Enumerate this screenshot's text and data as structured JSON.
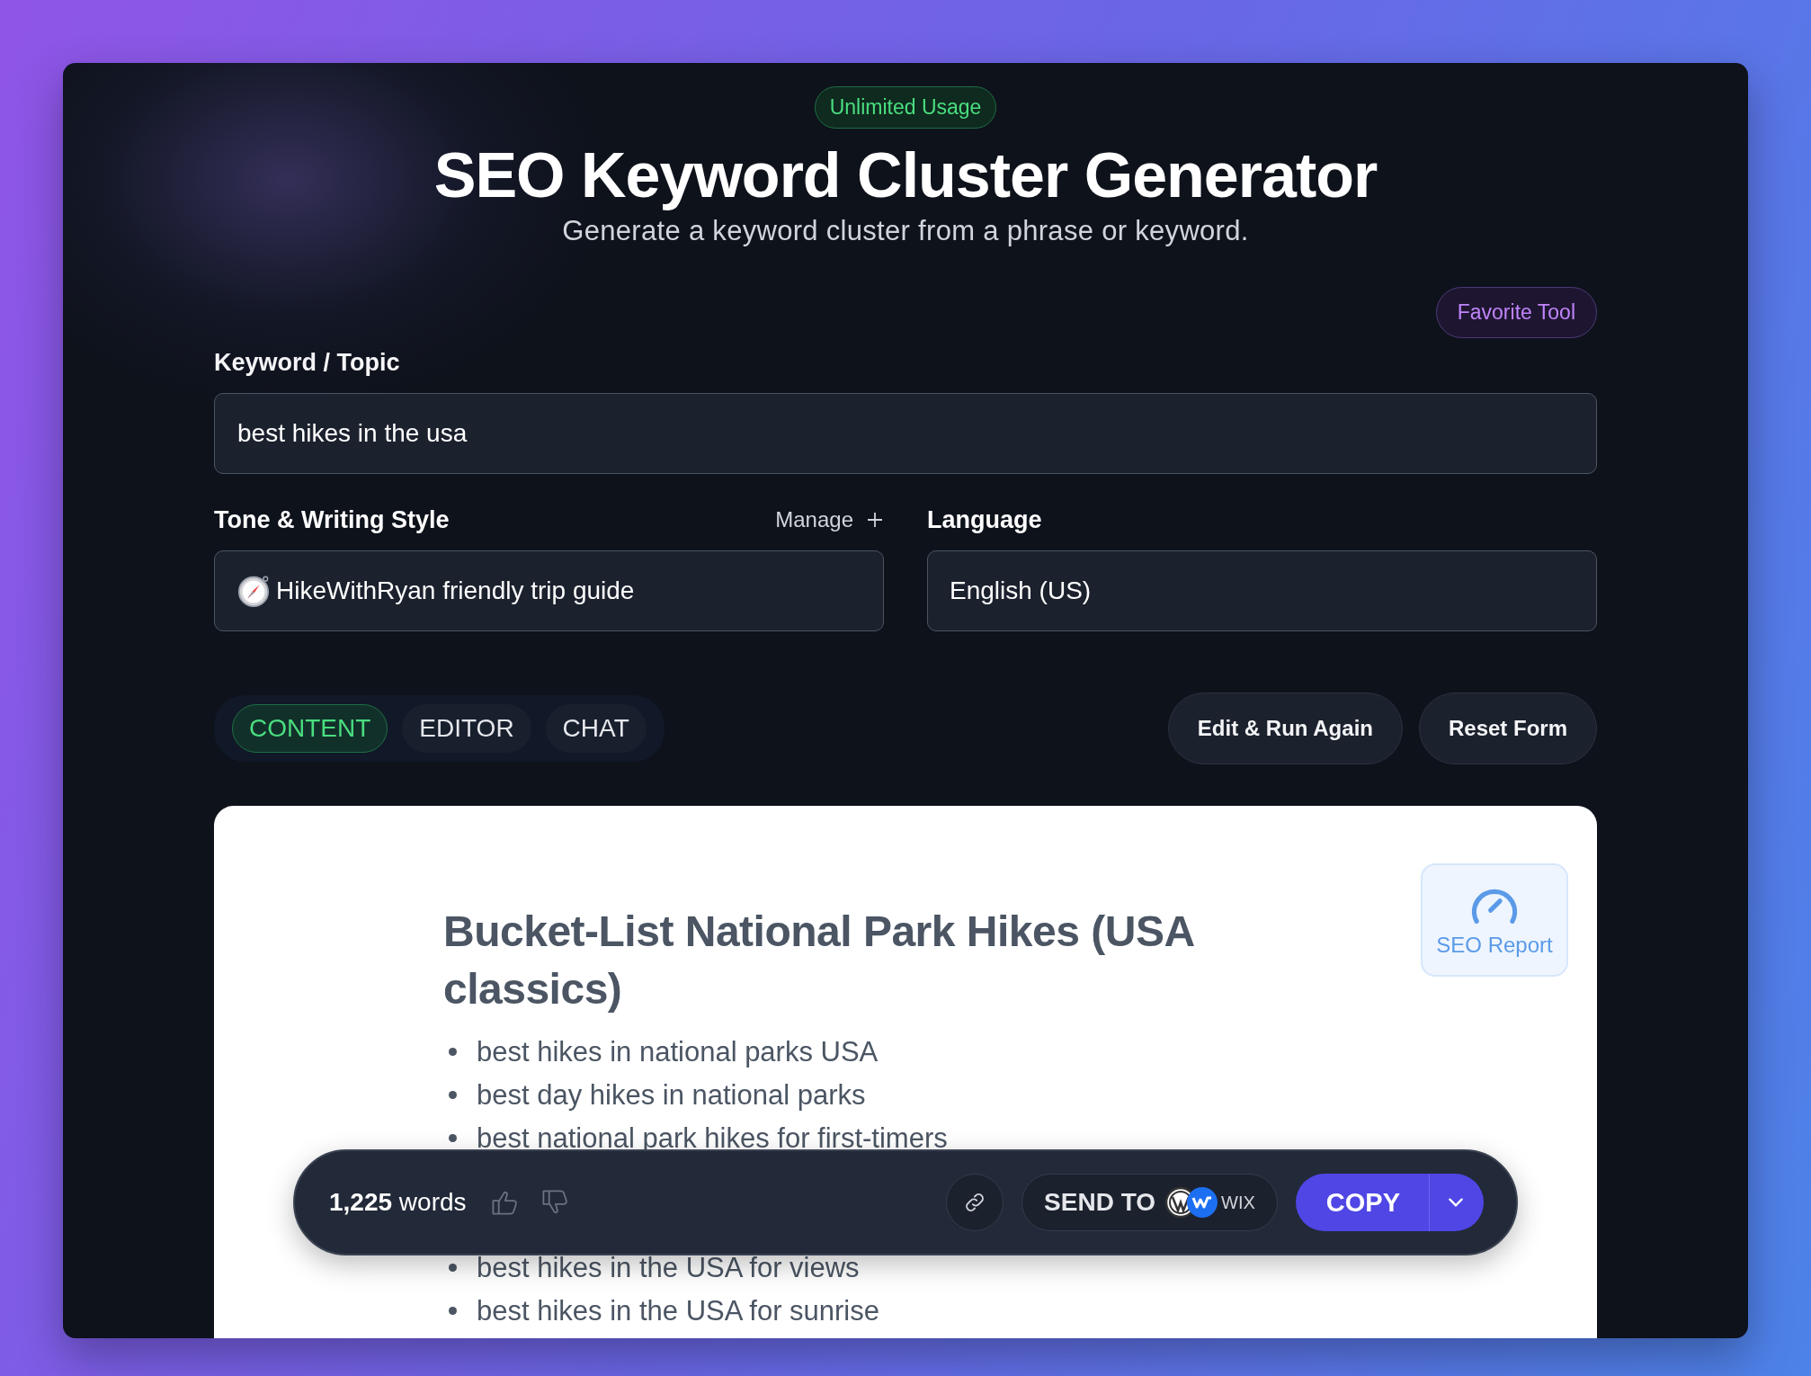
{
  "badge": "Unlimited Usage",
  "title": "SEO Keyword Cluster Generator",
  "subtitle": "Generate a keyword cluster from a phrase or keyword.",
  "favorite_button": "Favorite Tool",
  "keyword_field": {
    "label": "Keyword / Topic",
    "value": "best hikes in the usa"
  },
  "tone_field": {
    "label": "Tone & Writing Style",
    "manage_link": "Manage",
    "value": "HikeWithRyan friendly trip guide"
  },
  "language_field": {
    "label": "Language",
    "value": "English (US)"
  },
  "tabs": [
    {
      "label": "CONTENT",
      "selected": true
    },
    {
      "label": "EDITOR",
      "selected": false
    },
    {
      "label": "CHAT",
      "selected": false
    }
  ],
  "actions": [
    "Edit & Run Again",
    "Reset Form"
  ],
  "result": {
    "heading": "Bucket-List National Park Hikes (USA classics)",
    "seo_report": "SEO Report",
    "keywords_above": [
      "best hikes in national parks USA",
      "best day hikes in national parks",
      "best national park hikes for first-timers"
    ],
    "keywords_below": [
      "best hikes in the USA for views",
      "best hikes in the USA for sunrise"
    ]
  },
  "toolbar": {
    "word_count": "**1,225** words",
    "send_to": "SEND TO",
    "wix": "WIX",
    "copy": "COPY"
  }
}
